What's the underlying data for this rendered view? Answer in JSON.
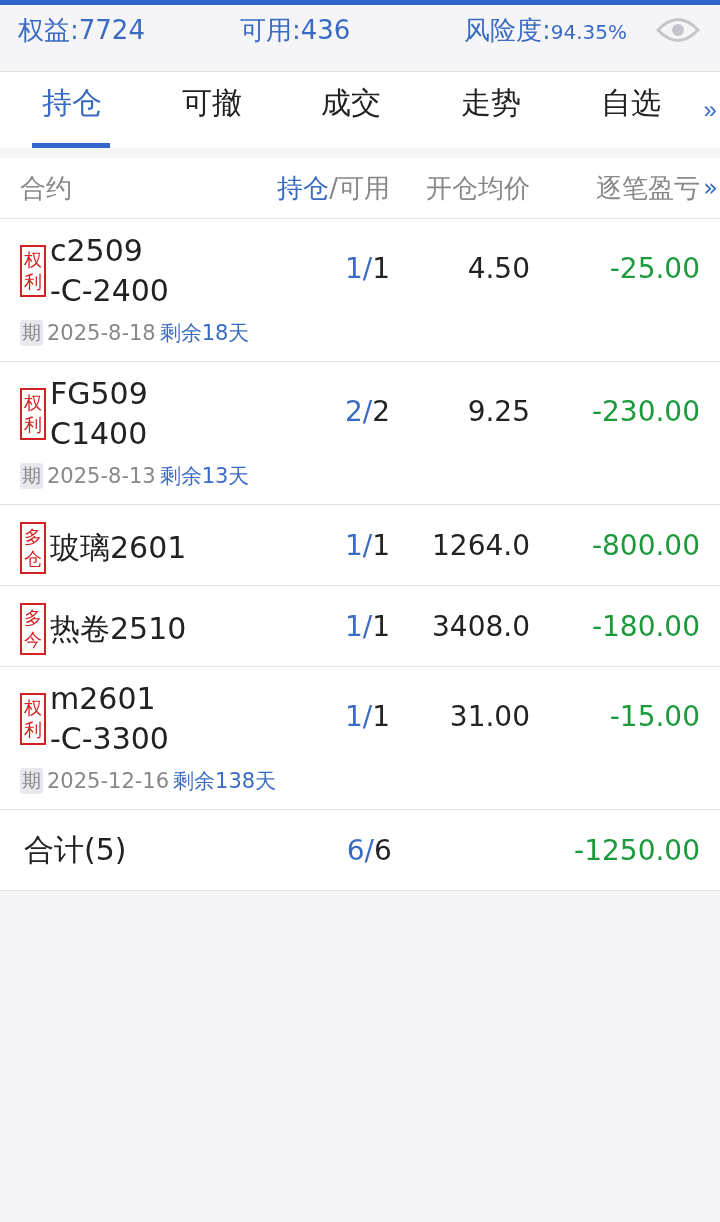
{
  "summary": [
    {
      "label": "权益:",
      "value": "7724"
    },
    {
      "label": "可用:",
      "value": "436"
    },
    {
      "label": "风险度:",
      "value": "94.35%"
    }
  ],
  "tabs": [
    {
      "label": "持仓",
      "selected": true
    },
    {
      "label": "可撤",
      "selected": false
    },
    {
      "label": "成交",
      "selected": false
    },
    {
      "label": "走势",
      "selected": false
    },
    {
      "label": "自选",
      "selected": false
    }
  ],
  "tabs_more": "»",
  "table": {
    "columns": {
      "contract": "合约",
      "position_held": "持仓",
      "position_available": "/可用",
      "avg_price": "开仓均价",
      "pnl": "逐笔盈亏",
      "more": "»"
    },
    "rows": [
      {
        "tag": "权利",
        "name_lines": [
          "c2509",
          "-C-2400"
        ],
        "held": "1/",
        "available": "1",
        "avg_price": "4.50",
        "pnl": "-25.00",
        "expiry": {
          "tag": "期",
          "date": "2025-8-18",
          "remaining": "剩余18天"
        }
      },
      {
        "tag": "权利",
        "name_lines": [
          "FG509",
          "C1400"
        ],
        "held": "2/",
        "available": "2",
        "avg_price": "9.25",
        "pnl": "-230.00",
        "expiry": {
          "tag": "期",
          "date": "2025-8-13",
          "remaining": "剩余13天"
        }
      },
      {
        "tag": "多仓",
        "name_lines": [
          "玻璃2601"
        ],
        "held": "1/",
        "available": "1",
        "avg_price": "1264.0",
        "pnl": "-800.00"
      },
      {
        "tag": "多今",
        "name_lines": [
          "热卷2510"
        ],
        "held": "1/",
        "available": "1",
        "avg_price": "3408.0",
        "pnl": "-180.00"
      },
      {
        "tag": "权利",
        "name_lines": [
          "m2601",
          "-C-3300"
        ],
        "held": "1/",
        "available": "1",
        "avg_price": "31.00",
        "pnl": "-15.00",
        "expiry": {
          "tag": "期",
          "date": "2025-12-16",
          "remaining": "剩余138天"
        }
      }
    ],
    "total": {
      "label": "合计(5)",
      "held": "6/",
      "available": "6",
      "pnl": "-1250.00"
    }
  }
}
